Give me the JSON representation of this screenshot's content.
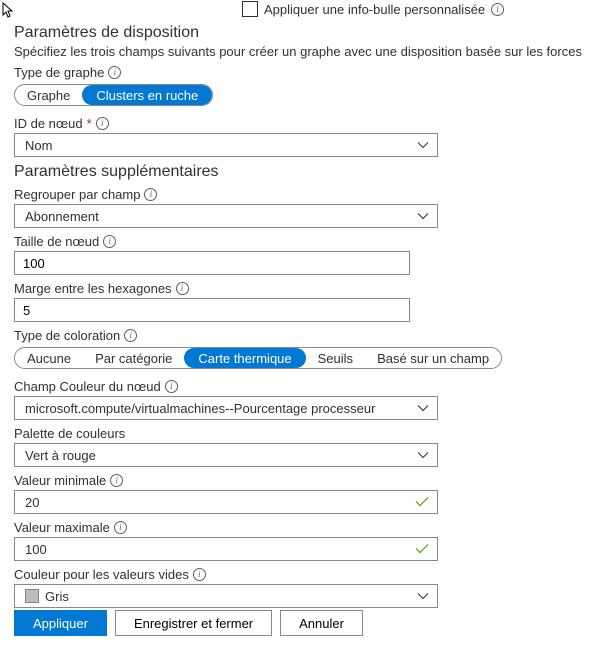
{
  "topCheckbox": {
    "label": "Appliquer une info-bulle personnalisée"
  },
  "layout": {
    "title": "Paramètres de disposition",
    "desc": "Spécifiez les trois champs suivants pour créer un graphe avec une disposition basée sur les forces"
  },
  "graphType": {
    "label": "Type de graphe",
    "options": [
      "Graphe",
      "Clusters en ruche"
    ],
    "selected": "Clusters en ruche"
  },
  "nodeId": {
    "label": "ID de nœud",
    "value": "Nom"
  },
  "extraTitle": "Paramètres supplémentaires",
  "groupBy": {
    "label": "Regrouper par champ",
    "value": "Abonnement"
  },
  "nodeSize": {
    "label": "Taille de nœud",
    "value": "100"
  },
  "hexMargin": {
    "label": "Marge entre les hexagones",
    "value": "5"
  },
  "colorType": {
    "label": "Type de coloration",
    "options": [
      "Aucune",
      "Par catégorie",
      "Carte thermique",
      "Seuils",
      "Basé sur un champ"
    ],
    "selected": "Carte thermique"
  },
  "colorField": {
    "label": "Champ Couleur du nœud",
    "value": "microsoft.compute/virtualmachines--Pourcentage processeur"
  },
  "palette": {
    "label": "Palette de couleurs",
    "value": "Vert à rouge"
  },
  "minVal": {
    "label": "Valeur minimale",
    "value": "20"
  },
  "maxVal": {
    "label": "Valeur maximale",
    "value": "100"
  },
  "emptyColor": {
    "label": "Couleur pour les valeurs vides",
    "value": "Gris"
  },
  "buttons": {
    "apply": "Appliquer",
    "save": "Enregistrer et fermer",
    "cancel": "Annuler"
  }
}
